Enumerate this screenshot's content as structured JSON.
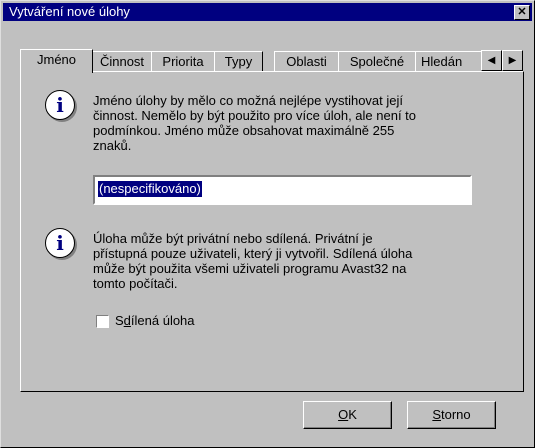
{
  "window": {
    "title": "Vytváření nové úlohy"
  },
  "tabs": [
    "Jméno",
    "Činnost",
    "Priorita",
    "Typy",
    "Oblasti",
    "Společné",
    "Hledán"
  ],
  "section1": {
    "text_lines": [
      "Jméno úlohy by mělo co možná nejlépe vystihovat její",
      "činnost. Nemělo by být použito pro více úloh, ale není to",
      "podmínkou. Jméno může obsahovat maximálně 255",
      "znaků."
    ],
    "name_value": "(nespecifikováno)"
  },
  "section2": {
    "text_lines": [
      "Úloha může být privátní nebo sdílená. Privátní je",
      "přístupná pouze uživateli, který ji vytvořil.  Sdílená úloha",
      "může být použita všemi uživateli programu Avast32 na",
      "tomto počítači."
    ],
    "shared_checkbox": {
      "label_prefix": "S",
      "label_ul": "d",
      "label_rest": "ílená úloha",
      "checked": false
    }
  },
  "buttons": {
    "ok": {
      "ul": "O",
      "rest": "K"
    },
    "cancel": {
      "ul": "S",
      "rest": "torno"
    }
  }
}
